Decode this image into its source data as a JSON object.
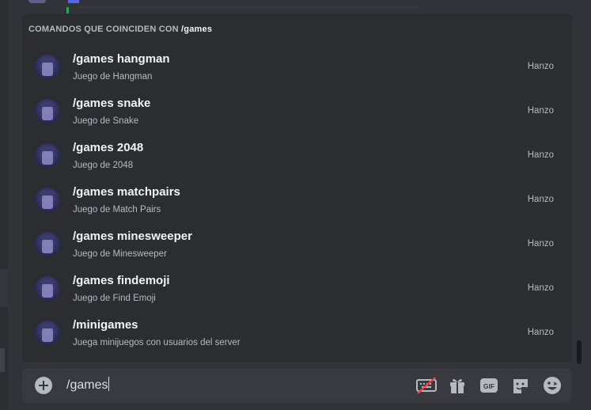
{
  "autocomplete": {
    "header_prefix": "COMANDOS QUE COINCIDEN CON ",
    "header_query": "/games",
    "commands": [
      {
        "name": "/games hangman",
        "description": "Juego de Hangman",
        "source": "Hanzo"
      },
      {
        "name": "/games snake",
        "description": "Juego de Snake",
        "source": "Hanzo"
      },
      {
        "name": "/games 2048",
        "description": "Juego de 2048",
        "source": "Hanzo"
      },
      {
        "name": "/games matchpairs",
        "description": "Juego de Match Pairs",
        "source": "Hanzo"
      },
      {
        "name": "/games minesweeper",
        "description": "Juego de Minesweeper",
        "source": "Hanzo"
      },
      {
        "name": "/games findemoji",
        "description": "Juego de Find Emoji",
        "source": "Hanzo"
      },
      {
        "name": "/minigames",
        "description": "Juega minijuegos con usuarios del server",
        "source": "Hanzo"
      }
    ]
  },
  "composer": {
    "input_value": "/games",
    "icons": [
      "add-icon",
      "keyboard-off-icon",
      "gift-icon",
      "gif-icon",
      "sticker-icon",
      "emoji-icon"
    ],
    "gif_label": "GIF"
  },
  "colors": {
    "background": "#313338",
    "popup": "#2b2d31",
    "composer": "#383a40",
    "text_primary": "#f2f3f5",
    "text_muted": "#b5bac1",
    "strike_red": "#f23f42"
  }
}
